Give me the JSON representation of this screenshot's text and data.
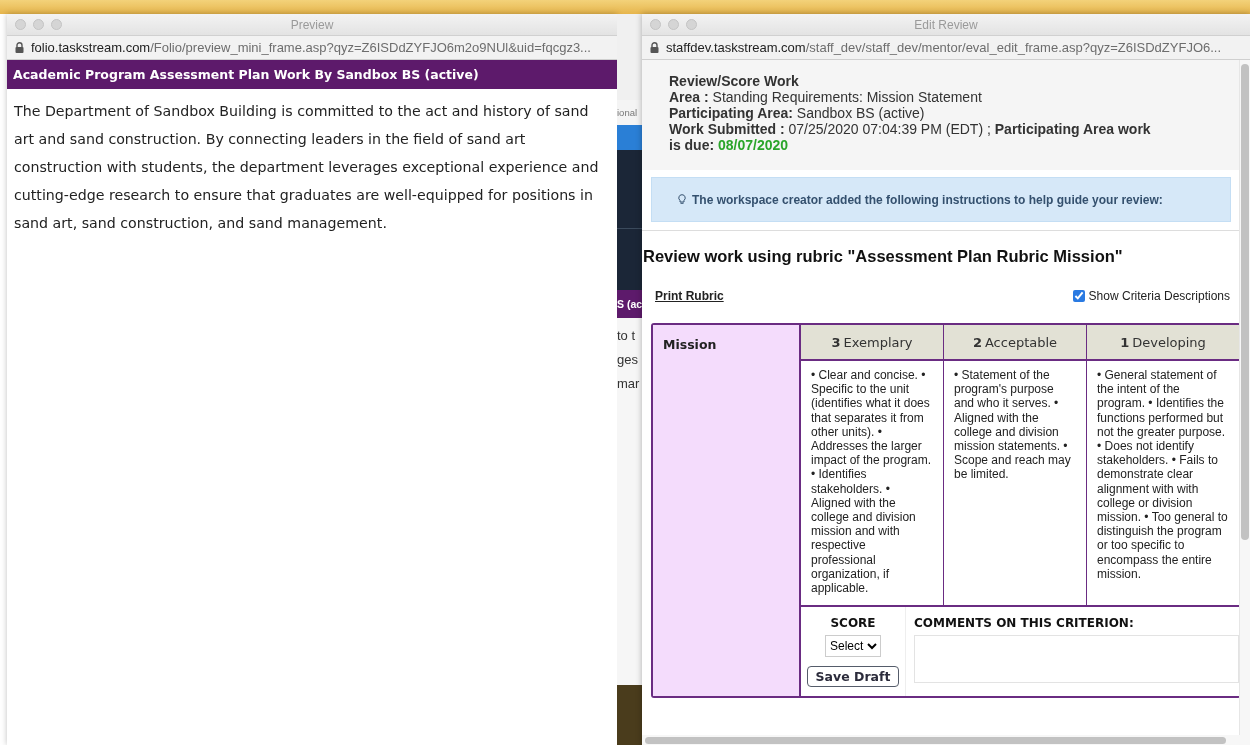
{
  "preview_window": {
    "title": "Preview",
    "url_host": "folio.taskstream.com",
    "url_path": "/Folio/preview_mini_frame.asp?qyz=Z6ISDdZYFJO6m2o9NUl&uid=fqcgz3...",
    "banner": "Academic Program Assessment Plan Work By Sandbox BS (active)",
    "body": "The Department of Sandbox Building is committed to the act and history of sand art and sand construction. By connecting leaders in the field of sand art construction with students, the department leverages exceptional experience and cutting-edge research to ensure that graduates are well-equipped for positions in sand art, sand construction, and sand management."
  },
  "background_window": {
    "fragments": [
      {
        "kind": "tab",
        "text": "ional"
      },
      {
        "kind": "banner",
        "text": "S (ac"
      },
      {
        "kind": "text",
        "text": "to t"
      },
      {
        "kind": "text",
        "text": "ges"
      },
      {
        "kind": "text",
        "text": "mar"
      }
    ]
  },
  "review_window": {
    "title": "Edit Review",
    "url_host": "staffdev.taskstream.com",
    "url_path": "/staff_dev/staff_dev/mentor/eval_edit_frame.asp?qyz=Z6ISDdZYFJO6...",
    "header": {
      "title": "Review/Score Work",
      "lines": [
        "**Area :** Standing Requirements: Mission Statement",
        "**Participating Area:** Sandbox BS (active)",
        "**Work Submitted :** 07/25/2020 07:04:39 PM (EDT) ; **Participating Area work is due:**"
      ],
      "due_date": "08/07/2020"
    },
    "instructions": "The workspace creator added the following instructions to help guide your review:",
    "rubric_heading": "Review work using rubric \"Assessment Plan Rubric Mission\"",
    "print_rubric": "Print Rubric",
    "show_descriptions": {
      "label": "Show Criteria Descriptions",
      "checked": true
    },
    "criterion": {
      "name": "Mission",
      "levels": [
        {
          "score": "3",
          "label": "Exemplary",
          "description": "• Clear and concise. • Specific to the unit (identifies what it does that separates it from other units). • Addresses the larger impact of the program. • Identifies stakeholders. • Aligned with the college and division mission and with respective professional organization, if applicable."
        },
        {
          "score": "2",
          "label": "Acceptable",
          "description": "• Statement of the program's purpose and who it serves. • Aligned with the college and division mission statements. • Scope and reach may be limited."
        },
        {
          "score": "1",
          "label": "Developing",
          "description": "• General statement of the intent of the program. • Identifies the functions performed but not the greater purpose. • Does not identify stakeholders. • Fails to demonstrate clear alignment with with college or division mission. • Too general to distinguish the program or too specific to encompass the entire mission."
        }
      ]
    },
    "score_label": "SCORE",
    "score_select": "Select",
    "save_button": "Save Draft",
    "comments_label": "COMMENTS ON THIS CRITERION:"
  }
}
